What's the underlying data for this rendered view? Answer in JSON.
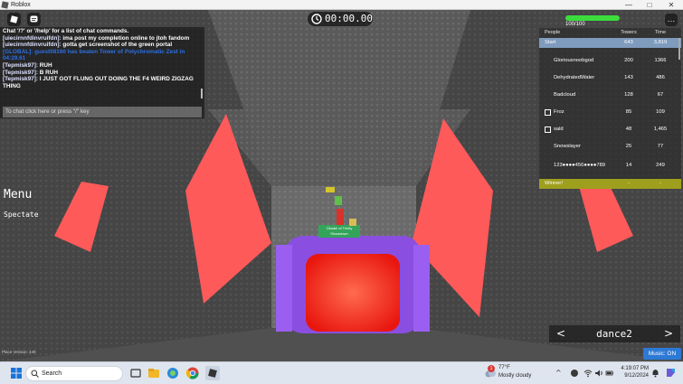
{
  "window": {
    "title": "Roblox",
    "min": "—",
    "max": "□",
    "close": "✕"
  },
  "hud": {
    "timer": "00:00.00",
    "health_text": "100/100",
    "health_fraction": 1.0,
    "menu_dots": "…",
    "roblox_button_icon": "roblox-logo-icon",
    "chat_button_icon": "chat-bubble-icon"
  },
  "chat": {
    "lines": [
      {
        "name": "",
        "text": "Chat '/?' or '/help' for a list of chat commands.",
        "kind": "info"
      },
      {
        "name": "[uiecirnnfdinvruifdn]:",
        "text": " ima post my completion online to jtoh fandom",
        "kind": "msg"
      },
      {
        "name": "[uiecirnnfdinvruifdn]:",
        "text": " gotta get screenshot of the green portal",
        "kind": "msg"
      },
      {
        "name": "",
        "text": "[GLOBAL]: guest08160 has beaten Tower of Polychromatic Zest in 04:29.61",
        "kind": "sys"
      },
      {
        "name": "[Tepmisk97]:",
        "text": " RUH",
        "kind": "msg"
      },
      {
        "name": "[Tepmisk97]:",
        "text": " B RUH",
        "kind": "msg"
      },
      {
        "name": "[Tepmisk97]:",
        "text": " I JUST GOT FLUNG OUT DOING THE F4 WEIRD ZIGZAG THING",
        "kind": "msg"
      }
    ],
    "input_placeholder": "To chat click here or press \"/\" key"
  },
  "menu": {
    "title": "Menu",
    "spectate": "Spectate"
  },
  "place_version": "Place Version: 449",
  "sign_text": [
    "Citadel of Trinity",
    "Showdown"
  ],
  "leaderboard": {
    "headers": {
      "people": "People",
      "towers": "Towers",
      "time": "Time"
    },
    "rows": [
      {
        "name": "Start",
        "towers": "643",
        "time": "3,819",
        "style": "start"
      },
      {
        "name": "Gloriousnoobgod",
        "towers": "200",
        "time": "1366",
        "style": "player"
      },
      {
        "name": "DehydratedWater",
        "towers": "143",
        "time": "486",
        "style": "player"
      },
      {
        "name": "Badcloud",
        "towers": "128",
        "time": "67",
        "style": "player"
      },
      {
        "name": "Froz",
        "towers": "85",
        "time": "109",
        "style": "team"
      },
      {
        "name": "sald",
        "towers": "48",
        "time": "1,465",
        "style": "team"
      },
      {
        "name": "Snowslayer",
        "towers": "25",
        "time": "77",
        "style": "player"
      },
      {
        "name": "123●●●●456●●●●789",
        "towers": "14",
        "time": "249",
        "style": "player"
      },
      {
        "name": "Winner!",
        "towers": "-",
        "time": "-",
        "style": "winner"
      }
    ]
  },
  "emote": {
    "prev": "<",
    "name": "dance2",
    "next": ">"
  },
  "music": {
    "label": "Music: ON"
  },
  "taskbar": {
    "search_placeholder": "Search",
    "weather_temp": "77°F",
    "weather_desc": "Mostly cloudy",
    "weather_badge": "1",
    "time": "4:19:07 PM",
    "date": "9/12/2024",
    "tray_chevron": "^"
  },
  "colors": {
    "accent_red": "#ff4d4d",
    "portal_red": "#ff2a1a",
    "portal_purple": "#8a4fe0",
    "leaderboard_start": "#7f9bbe",
    "leaderboard_winner": "#9f9f1e",
    "health_green": "#3ddc3d",
    "music_blue": "#2d79d6"
  }
}
